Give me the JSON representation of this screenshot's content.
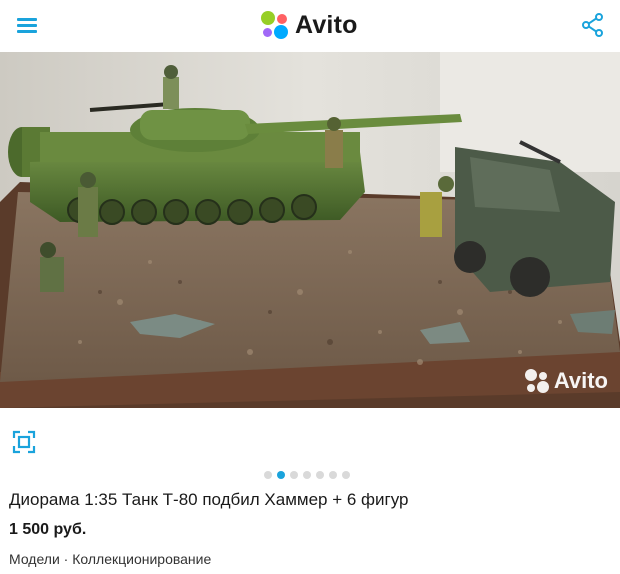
{
  "header": {
    "logo_text": "Avito",
    "menu_icon": "hamburger-menu-icon",
    "share_icon": "share-icon",
    "brand_colors": [
      "#00aaff",
      "#ff6163",
      "#97cf26",
      "#a169f7"
    ],
    "accent": "#1aa3dc"
  },
  "photo": {
    "watermark": "Avito"
  },
  "gallery": {
    "fullscreen_icon": "fullscreen-icon",
    "total_slides": 7,
    "active_slide": 2
  },
  "listing": {
    "title": "Диорама 1:35 Танк Т-80 подбил Хаммер + 6 фигур",
    "price": "1 500 руб.",
    "category": "Модели · Коллекционирование"
  }
}
